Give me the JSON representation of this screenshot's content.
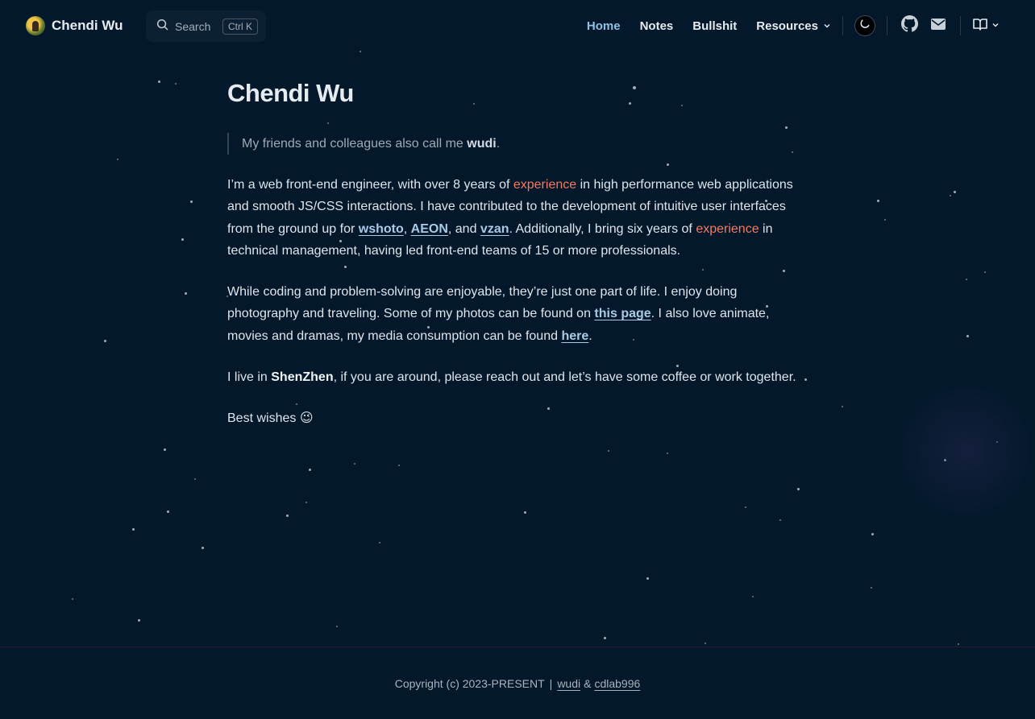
{
  "header": {
    "brand_name": "Chendi Wu",
    "search_label": "Search",
    "search_shortcut": "Ctrl K",
    "nav": [
      {
        "label": "Home",
        "active": true
      },
      {
        "label": "Notes"
      },
      {
        "label": "Bullshit"
      },
      {
        "label": "Resources"
      }
    ],
    "icons": [
      "moon-icon",
      "github-icon",
      "mail-icon",
      "book-icon",
      "chevron-down-icon"
    ]
  },
  "main": {
    "title": "Chendi Wu",
    "quote_prefix": "My friends and colleagues also call me ",
    "quote_bold": "wudi",
    "quote_suffix": ".",
    "p1": {
      "t1": "I’m a web front-end engineer, with over 8 years of ",
      "hl1": "experience",
      "t2": " in high performance web applications and smooth JS/CSS interactions. I have contributed to the development of intuitive user interfaces from the ground up for ",
      "link1": "wshoto",
      "t3": ", ",
      "link2": "AEON",
      "t4": ", and ",
      "link3": "vzan",
      "t5": ". Additionally, I bring six years of ",
      "hl2": "experience",
      "t6": " in technical management, having led front-end teams of 15 or more professionals."
    },
    "p2": {
      "t1": "While coding and problem-solving are enjoyable, they’re just one part of life. I enjoy doing photography and traveling. Some of my photos can be found on ",
      "link1": "this page",
      "t2": ". I also love animate, movies and dramas, my media consumption can be found ",
      "link2": "here",
      "t3": "."
    },
    "p3": {
      "t1": "I live in ",
      "bold": "ShenZhen",
      "t2": ", if you are around, please reach out and let’s have some coffee or work together."
    },
    "p4": "Best wishes 😉"
  },
  "footer": {
    "text": "Copyright (c) 2023-PRESENT",
    "sep": "|",
    "link1": "wudi",
    "amp": "&",
    "link2": "cdlab996"
  },
  "colors": {
    "background": "#03182b",
    "accent": "#8ec1e4",
    "highlight": "#f27b62",
    "link": "#a9cbe5"
  }
}
